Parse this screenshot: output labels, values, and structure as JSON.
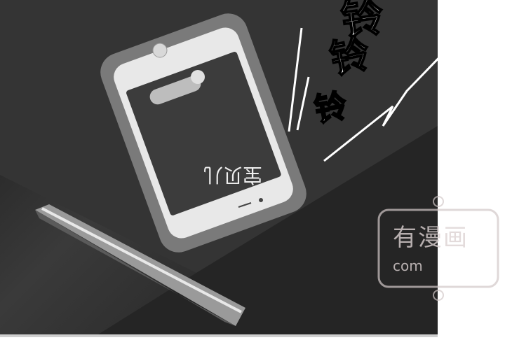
{
  "sfx": {
    "top": "铃",
    "mid": "铃",
    "low": "铃"
  },
  "phone": {
    "caller_name": "宝贝儿"
  },
  "watermark": {
    "main": "有漫画",
    "sub": "com"
  },
  "colors": {
    "panel_bg": "#2a2a2a",
    "sfx_fill": "#ffffff",
    "sfx_stroke": "#000000"
  }
}
